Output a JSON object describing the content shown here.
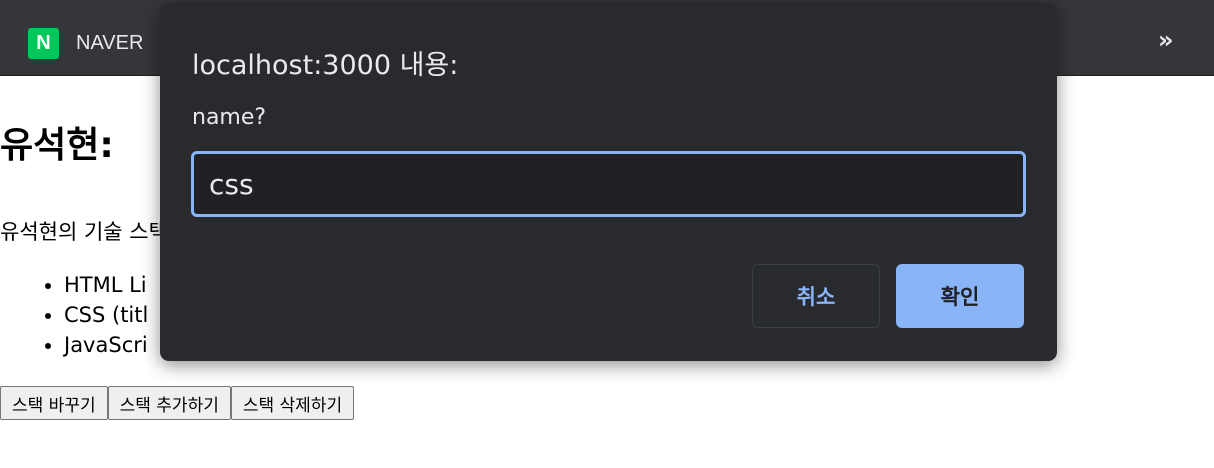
{
  "bookmarks": {
    "logo_letter": "N",
    "naver_label": "NAVER",
    "more_glyph": "»"
  },
  "page": {
    "title": "유석현: ",
    "description": "유석현의 기술 스택",
    "stack_items": [
      "HTML Li",
      "CSS (titl",
      "JavaScri"
    ],
    "buttons": [
      "스택 바꾸기",
      "스택 추가하기",
      "스택 삭제하기"
    ]
  },
  "dialog": {
    "title": "localhost:3000 내용:",
    "message": "name?",
    "input_value": "css",
    "cancel_label": "취소",
    "ok_label": "확인"
  },
  "colors": {
    "dialog_bg": "#292a2d",
    "accent": "#8ab4f8",
    "naver_green": "#03c75a",
    "toolbar_bg": "#35363a"
  }
}
